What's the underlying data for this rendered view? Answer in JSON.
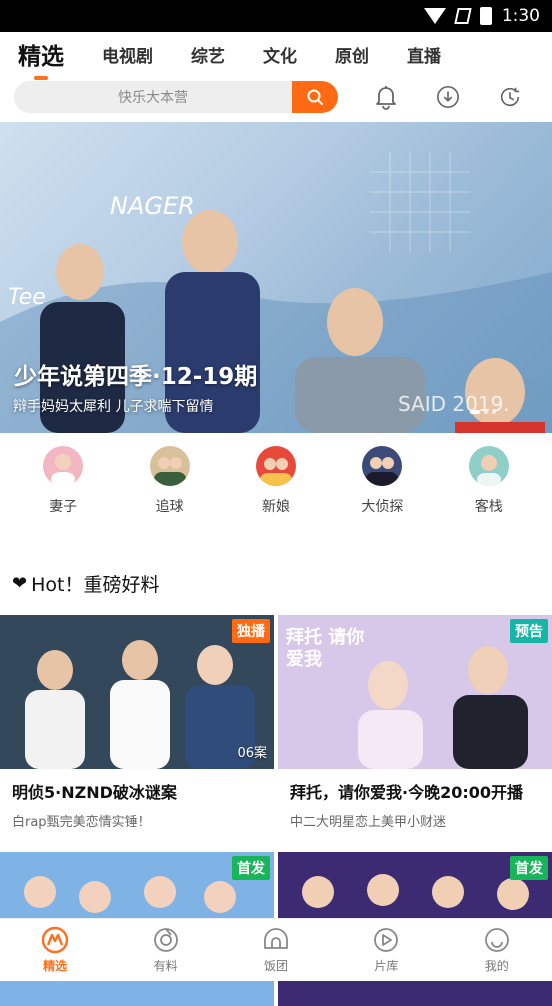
{
  "status_bar": {
    "time": "1:30"
  },
  "tabs": [
    {
      "label": "精选",
      "active": true
    },
    {
      "label": "电视剧",
      "active": false
    },
    {
      "label": "综艺",
      "active": false
    },
    {
      "label": "文化",
      "active": false
    },
    {
      "label": "原创",
      "active": false
    },
    {
      "label": "直播",
      "active": false
    }
  ],
  "search": {
    "placeholder": "快乐大本营"
  },
  "top_icons": [
    "bell-icon",
    "download-icon",
    "history-icon"
  ],
  "banner": {
    "title": "少年说第四季·12-19期",
    "subtitle": "辩手妈妈太犀利 儿子求喘下留情",
    "art_texts": {
      "left": "Tee",
      "top": "NAGER",
      "bottom": "SAID 2019."
    },
    "page_count": 3,
    "active_page": 1
  },
  "quick_links": [
    {
      "label": "妻子",
      "color": "#f3b6c3"
    },
    {
      "label": "追球",
      "color": "#d8c09a"
    },
    {
      "label": "新娘",
      "color": "#e7493b"
    },
    {
      "label": "大侦探",
      "color": "#3b4a78"
    },
    {
      "label": "客栈",
      "color": "#8fcfc7"
    }
  ],
  "section": {
    "icon": "❤",
    "title": "Hot！重磅好料"
  },
  "cards": [
    {
      "title": "明侦5·NZND破冰谜案",
      "subtitle": "白rap甄完美恋情实锤！",
      "badge": "独播",
      "badge_color": "#ff6a13",
      "episode": "06案",
      "bg": "#34485c"
    },
    {
      "title": "拜托，请你爱我·今晚20:00开播",
      "subtitle": "中二大明星恋上美甲小财迷",
      "badge": "预告",
      "badge_color": "#16b5a6",
      "episode": "",
      "bg": "#d7c7e8",
      "art_text": "拜托 请你爱我"
    },
    {
      "title": "",
      "subtitle": "",
      "badge": "首发",
      "badge_color": "#19b55a",
      "episode": "",
      "bg": "#7fb3e6"
    },
    {
      "title": "",
      "subtitle": "",
      "badge": "首发",
      "badge_color": "#19b55a",
      "episode": "",
      "bg": "#3c2a72"
    }
  ],
  "bottom_nav": [
    {
      "label": "精选",
      "active": true
    },
    {
      "label": "有料",
      "active": false
    },
    {
      "label": "饭团",
      "active": false
    },
    {
      "label": "片库",
      "active": false
    },
    {
      "label": "我的",
      "active": false
    }
  ]
}
